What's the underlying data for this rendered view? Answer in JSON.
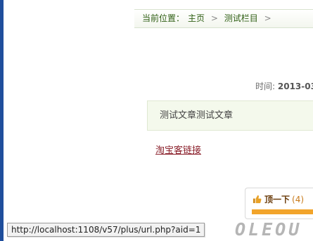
{
  "breadcrumb": {
    "label": "当前位置：",
    "items": [
      "主页",
      "测试栏目"
    ],
    "separator": ">"
  },
  "meta": {
    "time_label": "时间:",
    "time_value": "2013-03"
  },
  "article": {
    "summary": "测试文章测试文章",
    "link_text": "淘宝客链接"
  },
  "vote": {
    "label": "顶一下",
    "count": "(4)",
    "bar_fill_percent": 100
  },
  "status_bar": {
    "url": "http://localhost:1108/v57/plus/url.php?aid=1"
  },
  "watermark": {
    "text": "OLEOU"
  },
  "colors": {
    "breadcrumb_text": "#2f5f14",
    "link": "#8a1f2a",
    "vote_bar": "#f2a42b",
    "left_edge": "#1f4e9c"
  }
}
